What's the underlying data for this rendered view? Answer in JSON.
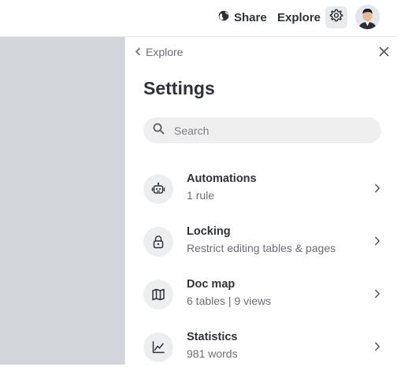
{
  "topbar": {
    "share_label": "Share",
    "explore_label": "Explore"
  },
  "panel": {
    "back_label": "Explore",
    "title": "Settings",
    "search_placeholder": "Search",
    "items": [
      {
        "title": "Automations",
        "subtitle": "1 rule",
        "icon": "robot-icon"
      },
      {
        "title": "Locking",
        "subtitle": "Restrict editing tables & pages",
        "icon": "lock-icon"
      },
      {
        "title": "Doc map",
        "subtitle": "6 tables | 9 views",
        "icon": "map-icon"
      },
      {
        "title": "Statistics",
        "subtitle": "981 words",
        "icon": "chart-icon"
      }
    ]
  },
  "colors": {
    "text": "#2f3237",
    "muted": "#6b6f75",
    "icon_bg": "#edeef0",
    "left_area": "#d2d5d9"
  }
}
